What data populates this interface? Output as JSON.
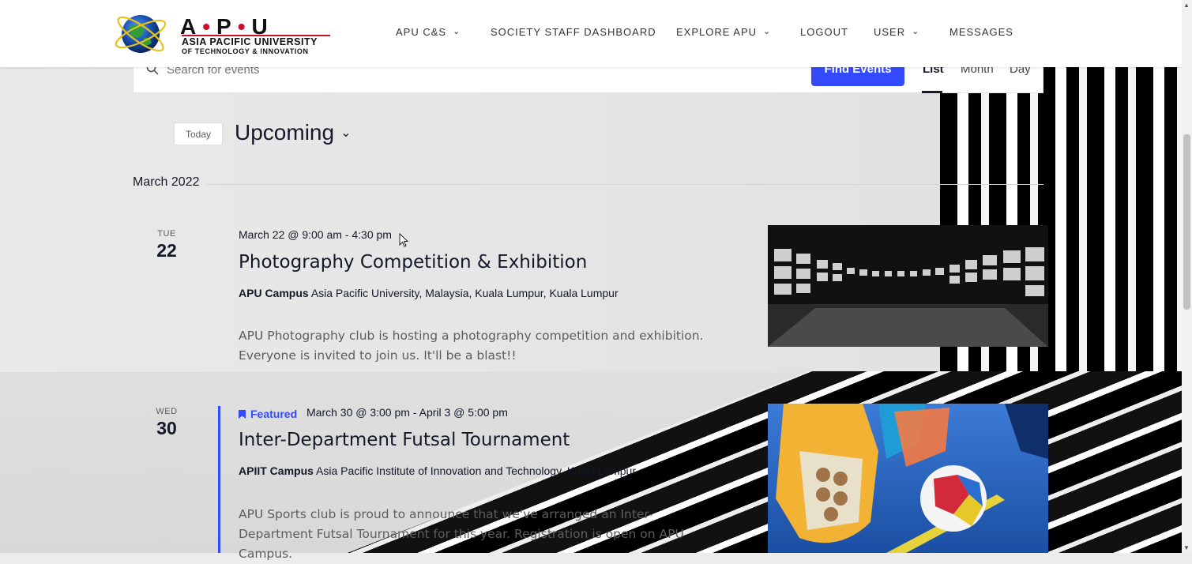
{
  "header": {
    "logo": {
      "brand_letters": [
        "A",
        "P",
        "U"
      ],
      "line1": "ASIA PACIFIC UNIVERSITY",
      "line2": "OF TECHNOLOGY & INNOVATION"
    },
    "nav": [
      {
        "label": "APU C&S",
        "dropdown": true
      },
      {
        "label": "SOCIETY STAFF DASHBOARD",
        "dropdown": false
      },
      {
        "label": "EXPLORE APU",
        "dropdown": true
      },
      {
        "label": "LOGOUT",
        "dropdown": false
      },
      {
        "label": "USER",
        "dropdown": true
      },
      {
        "label": "MESSAGES",
        "dropdown": false
      }
    ]
  },
  "search": {
    "placeholder": "Search for events",
    "button_label": "Find Events",
    "views": [
      "List",
      "Month",
      "Day"
    ],
    "active_view": "List"
  },
  "toolbar": {
    "today_label": "Today",
    "range_label": "Upcoming"
  },
  "month_label": "March 2022",
  "events": [
    {
      "dow": "TUE",
      "day": "22",
      "when": "March 22 @ 9:00 am - 4:30 pm",
      "title": "Photography Competition & Exhibition",
      "venue_name": "APU Campus",
      "venue_address": "Asia Pacific University, Malaysia, Kuala Lumpur, Kuala Lumpur",
      "description": "APU Photography club is hosting a photography competition and exhibition. Everyone is invited to join us. It'll be a blast!!",
      "featured": false
    },
    {
      "dow": "WED",
      "day": "30",
      "when": "March 30 @ 3:00 pm - April 3 @ 5:00 pm",
      "title": "Inter-Department Futsal Tournament",
      "venue_name": "APIIT Campus",
      "venue_address": "Asia Pacific Institute of Innovation and Technology, Kuala Lumpur",
      "description": "APU Sports club is proud to announce that we've arranged an Inter-Department Futsal Tournament for this year. Registration is open on APU Campus.",
      "featured": true,
      "featured_label": "Featured"
    }
  ],
  "colors": {
    "accent": "#334aff",
    "brand_red": "#c8102e",
    "text": "#141827",
    "muted": "#5d5d5d"
  }
}
